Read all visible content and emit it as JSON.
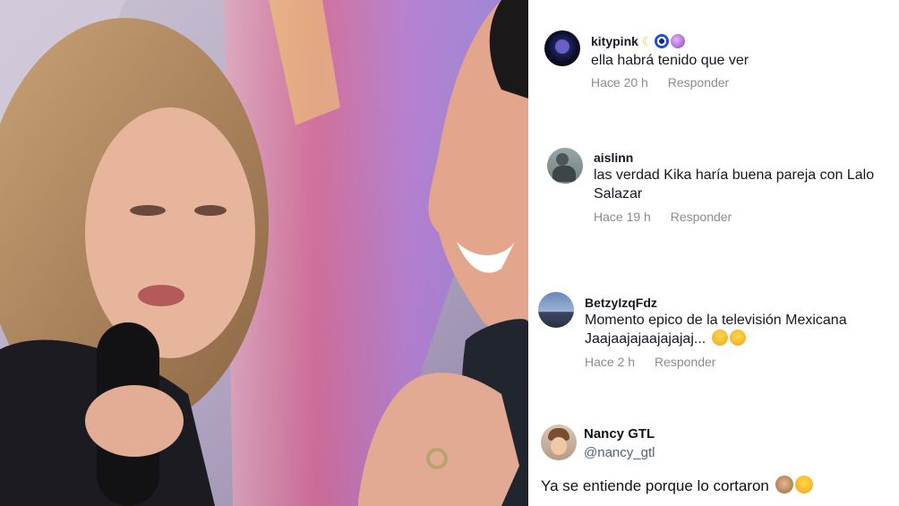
{
  "comments": [
    {
      "username": "kitypink",
      "username_emojis": [
        "moon-emoji",
        "evil-eye-emoji",
        "crystal-ball-emoji"
      ],
      "text": "ella habrá tenido que ver",
      "time": "Hace 20 h",
      "reply_label": "Responder"
    },
    {
      "username": "aislinn",
      "text": "las verdad Kika haría buena pareja con Lalo Salazar",
      "time": "Hace 19 h",
      "reply_label": "Responder"
    },
    {
      "username": "BetzyIzqFdz",
      "text_line1": "Momento epico de la televisión Mexicana",
      "text_line2": "Jaajaajajaajajajaj...",
      "text_emojis": [
        "crying-laughing-emoji",
        "tears-of-joy-emoji"
      ],
      "time": "Hace 2 h",
      "reply_label": "Responder"
    }
  ],
  "tweet": {
    "name": "Nancy GTL",
    "handle": "@nancy_gtl",
    "text": "Ya se entiende porque lo cortaron",
    "text_emojis": [
      "see-no-evil-monkey-emoji",
      "rolling-laughing-emoji"
    ]
  }
}
